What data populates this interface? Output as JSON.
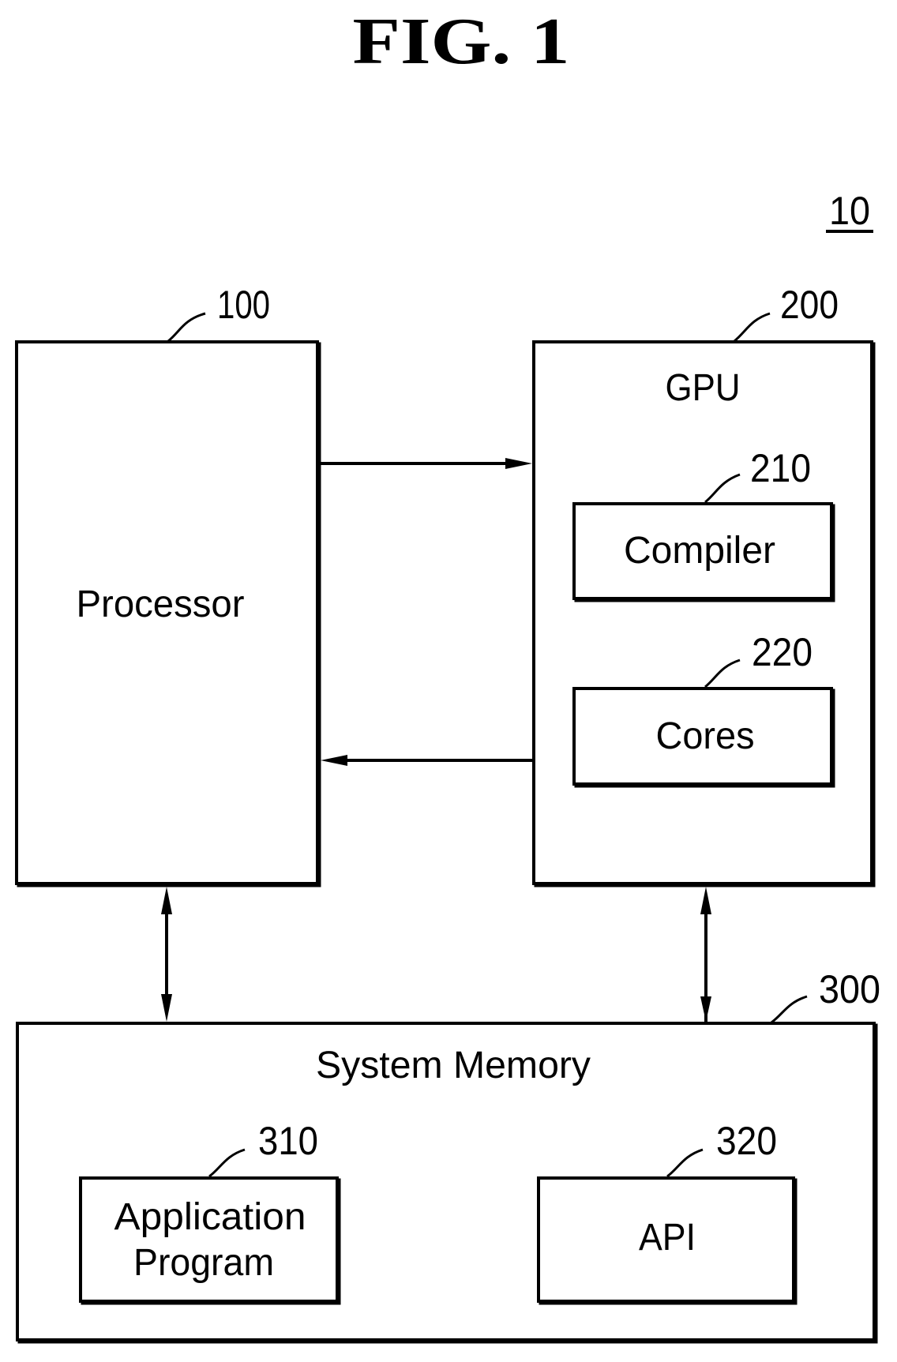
{
  "figure": {
    "title": "FIG. 1",
    "system_ref": "10"
  },
  "blocks": {
    "processor": {
      "label": "Processor",
      "ref": "100"
    },
    "gpu": {
      "label": "GPU",
      "ref": "200"
    },
    "compiler": {
      "label": "Compiler",
      "ref": "210"
    },
    "cores": {
      "label": "Cores",
      "ref": "220"
    },
    "system_memory": {
      "label": "System Memory",
      "ref": "300"
    },
    "application_program": {
      "label_lines": [
        "Application",
        "Program"
      ],
      "ref": "310"
    },
    "api": {
      "label": "API",
      "ref": "320"
    }
  },
  "connections": [
    {
      "from": "processor",
      "to": "gpu",
      "direction": "one-way"
    },
    {
      "from": "gpu",
      "to": "processor",
      "direction": "one-way"
    },
    {
      "from": "processor",
      "to": "system_memory",
      "direction": "two-way"
    },
    {
      "from": "gpu",
      "to": "system_memory",
      "direction": "two-way"
    }
  ],
  "colors": {
    "ink": "#000000",
    "background": "#ffffff"
  }
}
